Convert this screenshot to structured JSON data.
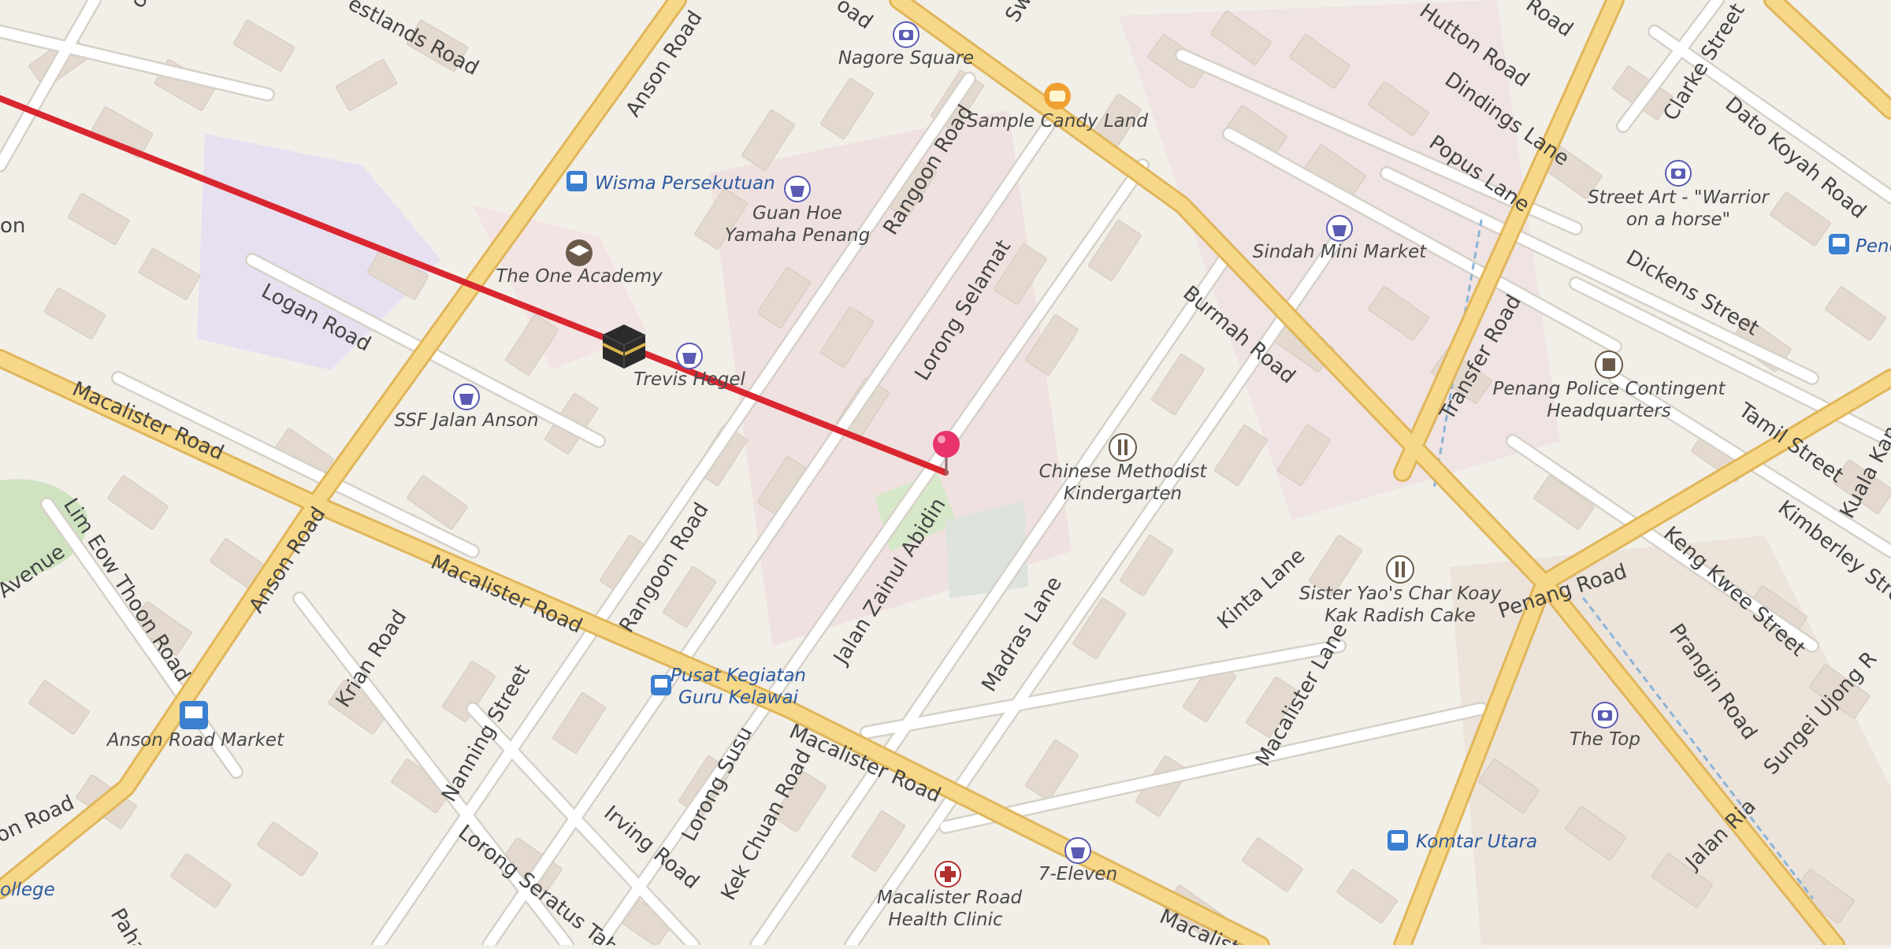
{
  "map": {
    "colors": {
      "background": "#f2efe9",
      "major_road": "#f5d27c",
      "major_road_casing": "#e0b65a",
      "minor_road": "#ffffff",
      "minor_road_casing": "#d6d1c8",
      "building": "#e3d9cf",
      "route_line": "#d9262f",
      "poi_shop": "#5b5bb4",
      "poi_camera": "#5b5bb4",
      "poi_bus": "#3b7fd0",
      "pin": "#e8336b"
    },
    "roads": [
      {
        "name": "Anson Road",
        "kind": "major"
      },
      {
        "name": "Macalister Road",
        "kind": "major"
      },
      {
        "name": "Burmah Road",
        "kind": "major"
      },
      {
        "name": "Penang Road",
        "kind": "major"
      },
      {
        "name": "Transfer Road",
        "kind": "major"
      },
      {
        "name": "Prangin Road",
        "kind": "major"
      },
      {
        "name": "Rangoon Road",
        "kind": "minor"
      },
      {
        "name": "Lorong Selamat",
        "kind": "minor"
      },
      {
        "name": "Jalan Zainul Abidin",
        "kind": "minor"
      },
      {
        "name": "Madras Lane",
        "kind": "minor"
      },
      {
        "name": "Kinta Lane",
        "kind": "minor"
      },
      {
        "name": "Macalister Lane",
        "kind": "minor"
      },
      {
        "name": "Logan Road",
        "kind": "minor"
      },
      {
        "name": "Lim Eow Thoon Road",
        "kind": "minor"
      },
      {
        "name": "Krian Road",
        "kind": "minor"
      },
      {
        "name": "Nanning Street",
        "kind": "minor"
      },
      {
        "name": "Lorong Seratus Tahun",
        "kind": "minor"
      },
      {
        "name": "Irving Road",
        "kind": "minor"
      },
      {
        "name": "Lorong Susu",
        "kind": "minor"
      },
      {
        "name": "Kek Chuan Road",
        "kind": "minor"
      },
      {
        "name": "Dindings Lane",
        "kind": "minor"
      },
      {
        "name": "Popus Lane",
        "kind": "minor"
      },
      {
        "name": "Dickens Street",
        "kind": "minor"
      },
      {
        "name": "Tamil Street",
        "kind": "minor"
      },
      {
        "name": "Keng Kwee Street",
        "kind": "minor"
      },
      {
        "name": "Kimberley Street",
        "kind": "minor"
      },
      {
        "name": "Clarke Street",
        "kind": "minor"
      },
      {
        "name": "Dato Koyah Road",
        "kind": "minor"
      },
      {
        "name": "Sungei Ujong Road",
        "kind": "minor"
      },
      {
        "name": "Jalan Ria",
        "kind": "minor"
      },
      {
        "name": "Hutton Road",
        "kind": "minor"
      }
    ],
    "labels": {
      "anson_road_1": "Anson Road",
      "anson_road_2": "Anson Road",
      "anson_road_3": "on Road",
      "macalister_1": "Macalister Road",
      "macalister_2": "Macalister Road",
      "macalister_3": "Macalister Road",
      "macalister_4": "Macalist",
      "burmah_road": "Burmah Road",
      "penang_road": "Penang Road",
      "transfer_road": "Transfer Road",
      "prangin_road": "Prangin Road",
      "rangoon_road_1": "Rangoon Road",
      "rangoon_road_2": "Rangoon Road",
      "lorong_selamat": "Lorong Selamat",
      "jalan_zainul": "Jalan Zainul Abidin",
      "madras_lane": "Madras Lane",
      "kinta_lane": "Kinta Lane",
      "macalister_lane": "Macalister Lane",
      "logan_road": "Logan Road",
      "lim_eow_thoon": "Lim Eow Thoon Road",
      "krian_road": "Krian Road",
      "nanning_street": "Nanning Street",
      "lorong_seratus": "Lorong Seratus Tahu",
      "irving_road": "Irving Road",
      "lorong_susu": "Lorong Susu",
      "kek_chuan": "Kek Chuan Road",
      "dindings_lane": "Dindings Lane",
      "popus_lane": "Popus Lane",
      "dickens_street": "Dickens Street",
      "tamil_street": "Tamil Street",
      "keng_kwee": "Keng Kwee Street",
      "kimberley": "Kimberley Stre",
      "clarke_street": "Clarke Street",
      "dato_koyah": "Dato Koyah Road",
      "sungei_ujong": "Sungei Ujong R",
      "jalan_ria": "Jalan Ria",
      "hutton_road": "Hutton Road",
      "westlands_road": "estlands Road",
      "avenue": "Avenue",
      "kuala": "Kuala Kan",
      "oad_1": "oad",
      "oad_2": "oad",
      "oad_3": "Road",
      "swa": "Swa",
      "pahang": "Paha",
      "on": "on"
    },
    "pois": [
      {
        "label": "Nagore Square",
        "icon": "camera-icon"
      },
      {
        "label": "Sample Candy Land",
        "icon": "candy-icon"
      },
      {
        "label": "Wisma Persekutuan",
        "icon": "bus-icon"
      },
      {
        "label": "Guan Hoe",
        "label2": "Yamaha Penang",
        "icon": "shop-icon"
      },
      {
        "label": "The One Academy",
        "icon": "school-icon"
      },
      {
        "label": "Trevis Hegel",
        "icon": "shop-icon"
      },
      {
        "label": "SSF Jalan Anson",
        "icon": "shop-icon"
      },
      {
        "label": "Sindah Mini Market",
        "icon": "shop-icon"
      },
      {
        "label": "Street Art - \"Warrior",
        "label2": "on a horse\"",
        "icon": "camera-icon"
      },
      {
        "label": "Penang Police Contingent",
        "label2": "Headquarters",
        "icon": "police-icon"
      },
      {
        "label": "Chinese Methodist",
        "label2": "Kindergarten",
        "icon": "kindergarten-icon"
      },
      {
        "label": "Sister Yao's Char Koay",
        "label2": "Kak Radish Cake",
        "icon": "restaurant-icon"
      },
      {
        "label": "Pusat Kegiatan",
        "label2": "Guru Kelawai",
        "icon": "bus-icon"
      },
      {
        "label": "Anson Road Market",
        "icon": "bus-icon"
      },
      {
        "label": "The Top",
        "icon": "camera-icon"
      },
      {
        "label": "Komtar Utara",
        "icon": "bus-icon"
      },
      {
        "label": "7-Eleven",
        "icon": "shop-icon"
      },
      {
        "label": "Macalister Road",
        "label2": "Health Clinic",
        "icon": "clinic-icon"
      },
      {
        "label": "Penc",
        "icon": "bus-icon"
      },
      {
        "label": "ollege",
        "icon": "none"
      }
    ],
    "route": {
      "kind": "qibla-line",
      "icon": "kaaba-icon"
    },
    "pin": {
      "icon": "location-pin-icon"
    }
  }
}
